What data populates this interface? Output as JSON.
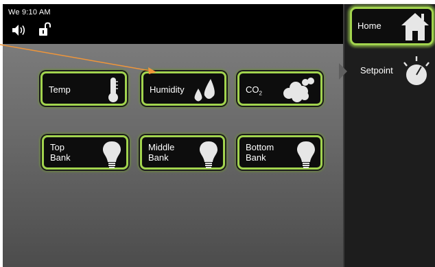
{
  "status_bar": {
    "clock": "We 9:10 AM"
  },
  "tiles": [
    {
      "label": "Temp",
      "icon": "thermometer-icon"
    },
    {
      "label": "Humidity",
      "icon": "droplets-icon"
    },
    {
      "label": "CO",
      "sub": "2",
      "icon": "cloud-icon"
    },
    {
      "label": "Top\nBank",
      "icon": "lightbulb-icon"
    },
    {
      "label": "Middle\nBank",
      "icon": "lightbulb-icon"
    },
    {
      "label": "Bottom\nBank",
      "icon": "lightbulb-icon"
    }
  ],
  "sidebar": {
    "home_label": "Home",
    "setpoint_label": "Setpoint"
  },
  "colors": {
    "tile_border": "#a2d44e",
    "tile_background": "#0d0d0d",
    "panel_background": "#6a6a6a",
    "annotation_arrow": "#f0963a"
  }
}
